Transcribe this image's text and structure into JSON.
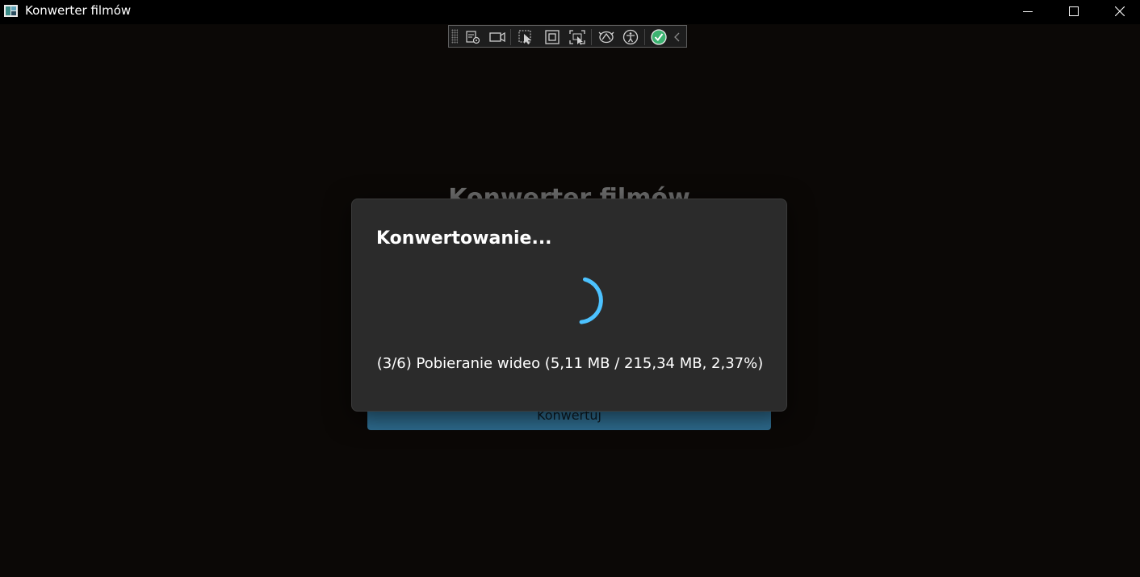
{
  "window": {
    "title": "Konwerter filmów"
  },
  "background": {
    "title": "Konwerter filmów",
    "convert_button_label": "Konwertuj"
  },
  "dialog": {
    "title": "Konwertowanie...",
    "status": "(3/6) Pobieranie wideo (5,11 MB / 215,34 MB, 2,37%)"
  },
  "colors": {
    "accent": "#4cc2ff",
    "dialog_bg": "#2b2b2b",
    "app_bg": "#0b0806",
    "convert_button": "#2f6f93",
    "toolbar_check": "#3cb371"
  },
  "toolbar": {
    "icons": [
      "live-visual-tree-icon",
      "video-camera-icon",
      "select-element-icon",
      "display-layout-adorners-icon",
      "track-focused-element-icon",
      "binding-failures-icon",
      "accessibility-icon",
      "checkmark-icon",
      "collapse-chevron-icon"
    ]
  }
}
